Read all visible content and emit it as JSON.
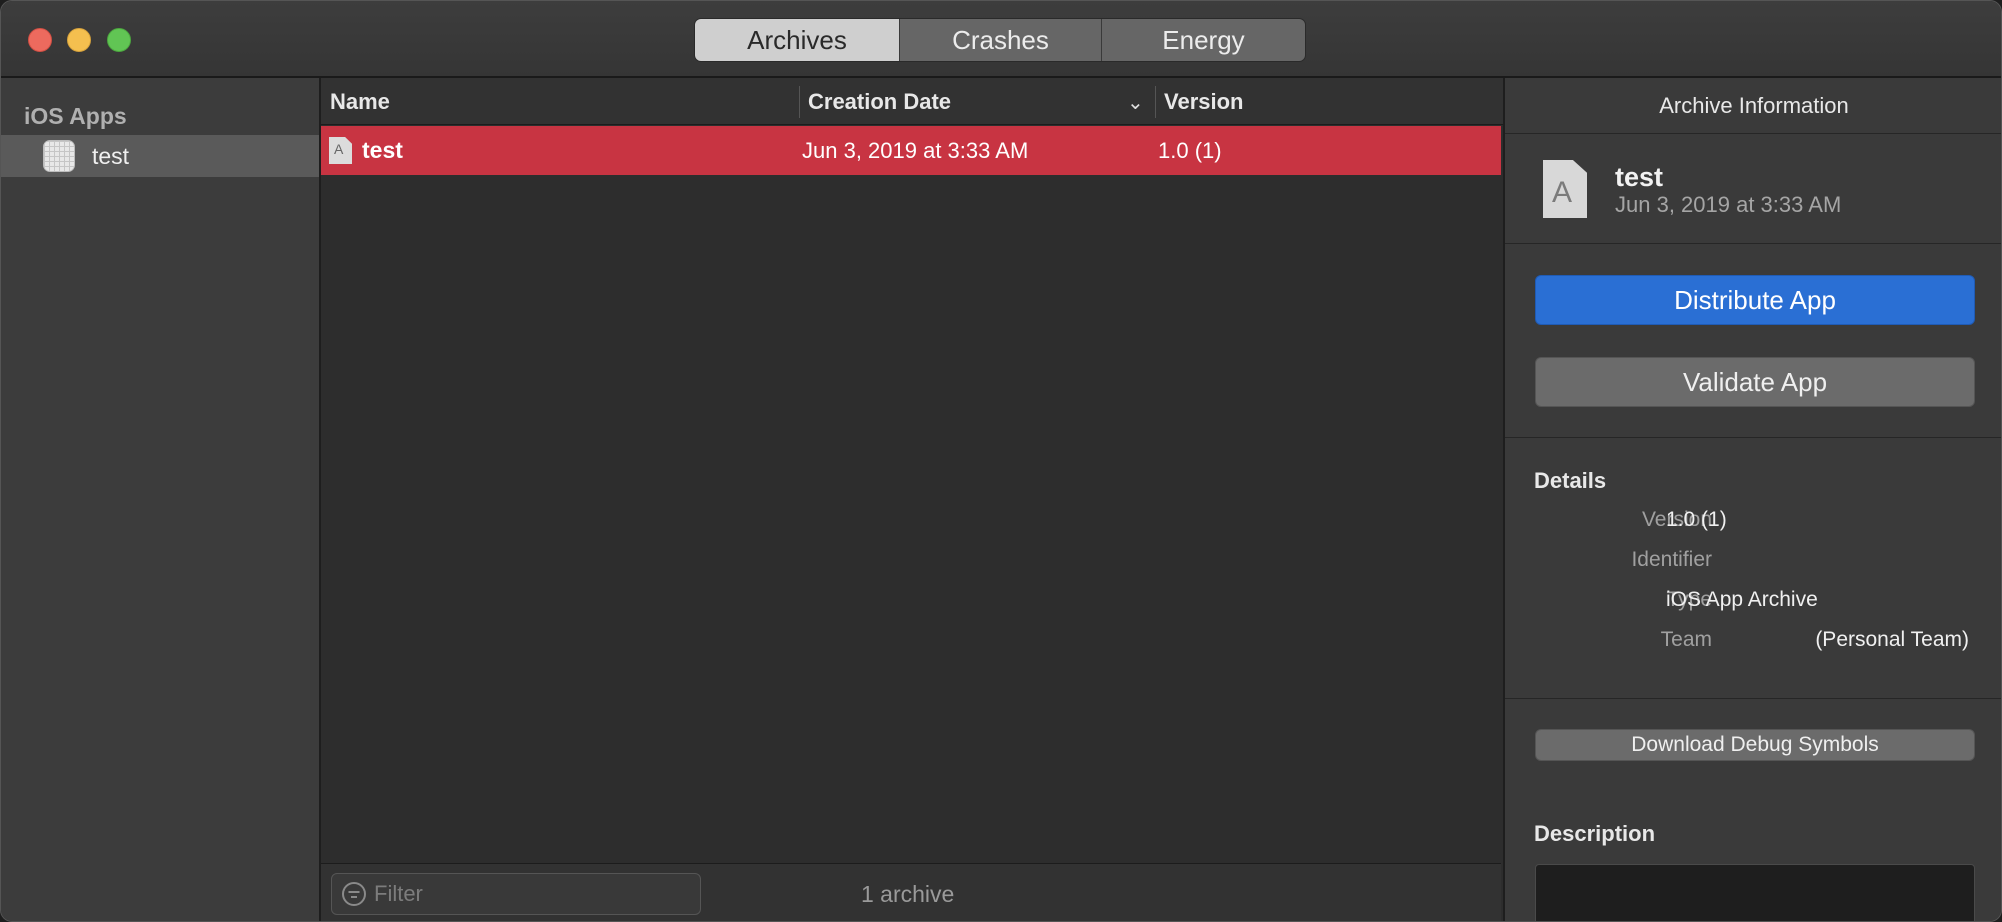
{
  "window": {
    "traffic_lights": [
      "close",
      "minimize",
      "maximize"
    ]
  },
  "toolbar": {
    "tabs": [
      {
        "label": "Archives",
        "active": true
      },
      {
        "label": "Crashes",
        "active": false
      },
      {
        "label": "Energy",
        "active": false
      }
    ]
  },
  "sidebar": {
    "header": "iOS Apps",
    "items": [
      {
        "label": "test",
        "icon": "app-icon",
        "selected": true
      }
    ]
  },
  "table": {
    "columns": {
      "name": "Name",
      "creation_date": "Creation Date",
      "version": "Version"
    },
    "sorted_by": "Creation Date",
    "rows": [
      {
        "name": "test",
        "creation_date": "Jun 3, 2019 at 3:33 AM",
        "version": "1.0 (1)",
        "selected": true
      }
    ]
  },
  "footer": {
    "filter_placeholder": "Filter",
    "archive_count": "1 archive"
  },
  "inspector": {
    "title": "Archive Information",
    "archive_name": "test",
    "archive_date": "Jun 3, 2019 at 3:33 AM",
    "distribute_label": "Distribute App",
    "validate_label": "Validate App",
    "details_title": "Details",
    "details": {
      "version_label": "Version",
      "version_value": "1.0 (1)",
      "identifier_label": "Identifier",
      "identifier_value": "",
      "type_label": "Type",
      "type_value": "iOS App Archive",
      "team_label": "Team",
      "team_value": "(Personal Team)"
    },
    "debug_symbols_label": "Download Debug Symbols",
    "description_title": "Description"
  },
  "colors": {
    "selection": "#c83442",
    "primary_button": "#2a6fd4"
  }
}
